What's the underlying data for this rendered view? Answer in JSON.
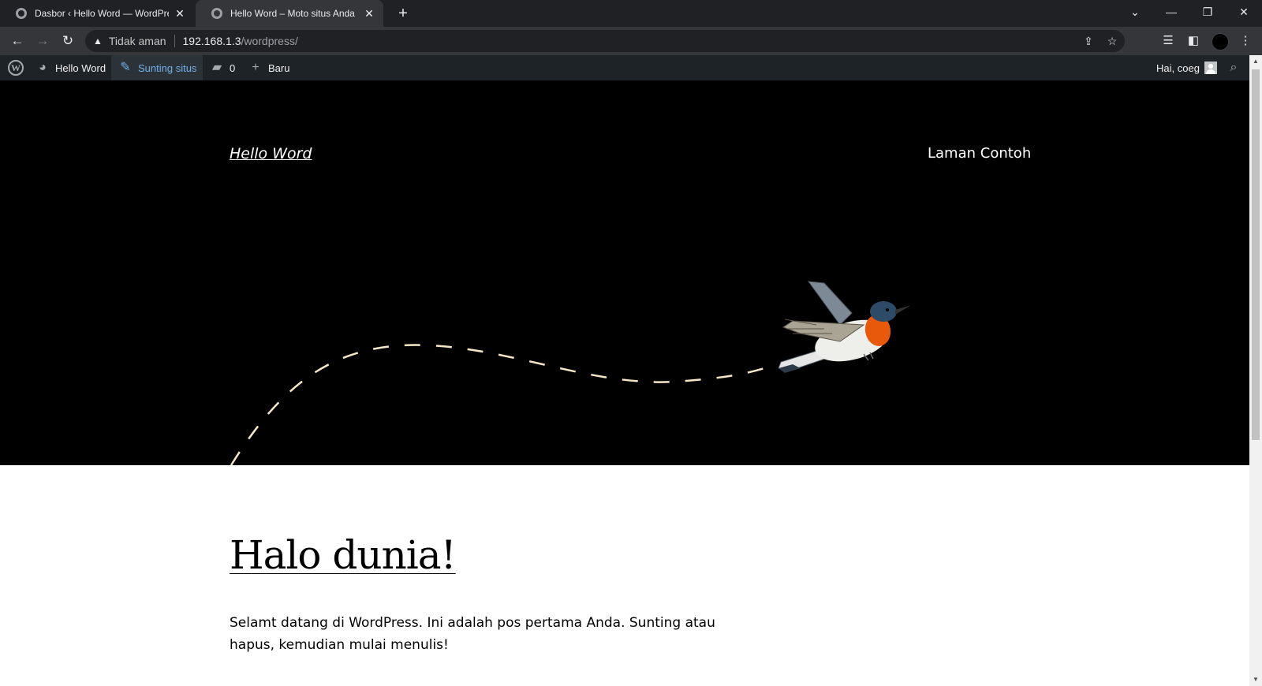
{
  "browser": {
    "tabs": [
      {
        "title": "Dasbor ‹ Hello Word — WordPress",
        "active": false
      },
      {
        "title": "Hello Word – Moto situs Anda bisa",
        "active": true
      }
    ],
    "security_label": "Tidak aman",
    "url_host": "192.168.1.3",
    "url_path": "/wordpress/"
  },
  "adminbar": {
    "site_name": "Hello Word",
    "edit_site": "Sunting situs",
    "comments_count": "0",
    "new_label": "Baru",
    "greeting": "Hai, coeg"
  },
  "site": {
    "title": "Hello Word",
    "nav_items": [
      "Laman Contoh"
    ]
  },
  "post": {
    "title": "Halo dunia!",
    "body": "Selamt datang di WordPress. Ini adalah pos pertama Anda. Sunting atau hapus, kemudian mulai menulis!"
  },
  "colors": {
    "adminbar_bg": "#1d2327",
    "adminbar_hover": "#72aee6",
    "header_bg": "#000000",
    "path_dash": "#f5e6c8",
    "bird_breast": "#e8590c"
  }
}
